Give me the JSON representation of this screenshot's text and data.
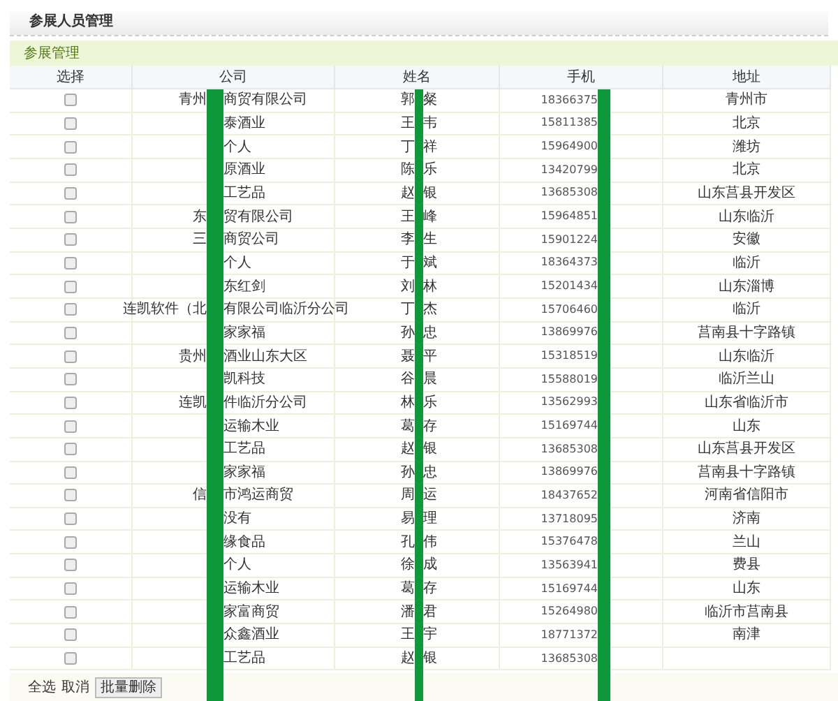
{
  "page_title": "参展人员管理",
  "section_title": "参展管理",
  "table": {
    "columns": [
      "选择",
      "公司",
      "姓名",
      "手机",
      "地址"
    ],
    "rows": [
      {
        "checked": false,
        "company_left": "青州",
        "company_right": "商贸有限公司",
        "name_left": "郭",
        "name_right": "粲",
        "phone": "18366375",
        "address": "青州市"
      },
      {
        "checked": false,
        "company_right": "泰酒业",
        "name_left": "王",
        "name_right": "韦",
        "phone": "15811385",
        "address": "北京"
      },
      {
        "checked": false,
        "company_right": "个人",
        "name_left": "丁",
        "name_right": "祥",
        "phone": "15964900",
        "address": "潍坊"
      },
      {
        "checked": false,
        "company_right": "原酒业",
        "name_left": "陈",
        "name_right": "乐",
        "phone": "13420799",
        "address": "北京"
      },
      {
        "checked": false,
        "company_right": "工艺品",
        "name_left": "赵",
        "name_right": "银",
        "phone": "13685308",
        "address": "山东莒县开发区"
      },
      {
        "checked": false,
        "company_left": "东",
        "company_right": "贸有限公司",
        "name_left": "王",
        "name_right": "峰",
        "phone": "15964851",
        "address": "山东临沂"
      },
      {
        "checked": false,
        "company_left": "三",
        "company_right": "商贸公司",
        "name_left": "李",
        "name_right": "生",
        "phone": "15901224",
        "address": "安徽"
      },
      {
        "checked": false,
        "company_right": "个人",
        "name_left": "于",
        "name_right": "斌",
        "phone": "18364373",
        "address": "临沂"
      },
      {
        "checked": false,
        "company_right": "东红剑",
        "name_left": "刘",
        "name_right": "林",
        "phone": "15201434",
        "address": "山东淄博"
      },
      {
        "checked": false,
        "company_left": "连凯软件（北",
        "company_right": "有限公司临沂分公司",
        "name_left": "丁",
        "name_right": "杰",
        "phone": "15706460",
        "address": "临沂"
      },
      {
        "checked": false,
        "company_right": "家家福",
        "name_left": "孙",
        "name_right": "忠",
        "phone": "13869976",
        "address": "莒南县十字路镇"
      },
      {
        "checked": false,
        "company_left": "贵州",
        "company_right": "酒业山东大区",
        "name_left": "聂",
        "name_right": "平",
        "phone": "15318519",
        "address": "山东临沂"
      },
      {
        "checked": false,
        "company_right": "凯科技",
        "name_left": "谷",
        "name_right": "晨",
        "phone": "15588019",
        "address": "临沂兰山"
      },
      {
        "checked": false,
        "company_left": "连凯",
        "company_right": "件临沂分公司",
        "name_left": "林",
        "name_right": "乐",
        "phone": "13562993",
        "address": "山东省临沂市"
      },
      {
        "checked": false,
        "company_right": "运输木业",
        "name_left": "葛",
        "name_right": "存",
        "phone": "15169744",
        "address": "山东"
      },
      {
        "checked": false,
        "company_right": "工艺品",
        "name_left": "赵",
        "name_right": "银",
        "phone": "13685308",
        "address": "山东莒县开发区"
      },
      {
        "checked": false,
        "company_right": "家家福",
        "name_left": "孙",
        "name_right": "忠",
        "phone": "13869976",
        "address": "莒南县十字路镇"
      },
      {
        "checked": false,
        "company_left": "信",
        "company_right": "市鸿运商贸",
        "name_left": "周",
        "name_right": "运",
        "phone": "18437652",
        "address": "河南省信阳市"
      },
      {
        "checked": false,
        "company_right": "没有",
        "name_left": "易",
        "name_right": "理",
        "phone": "13718095",
        "address": "济南"
      },
      {
        "checked": false,
        "company_right": "缘食品",
        "name_left": "孔",
        "name_right": "伟",
        "phone": "15376478",
        "address": "兰山"
      },
      {
        "checked": false,
        "company_right": "个人",
        "name_left": "徐",
        "name_right": "成",
        "phone": "13563941",
        "address": "费县"
      },
      {
        "checked": false,
        "company_right": "运输木业",
        "name_left": "葛",
        "name_right": "存",
        "phone": "15169744",
        "address": "山东"
      },
      {
        "checked": false,
        "company_right": "家富商贸",
        "name_left": "潘",
        "name_right": "君",
        "phone": "15264980",
        "address": "临沂市莒南县"
      },
      {
        "checked": false,
        "company_right": "众鑫酒业",
        "name_left": "王",
        "name_right": "宇",
        "phone": "18771372",
        "address": "南津"
      },
      {
        "checked": false,
        "company_right": "工艺品",
        "name_left": "赵",
        "name_right": "银",
        "phone": "13685308"
      }
    ]
  },
  "footer": {
    "select_all": "全选",
    "cancel": "取消",
    "batch_delete": "批量删除"
  }
}
